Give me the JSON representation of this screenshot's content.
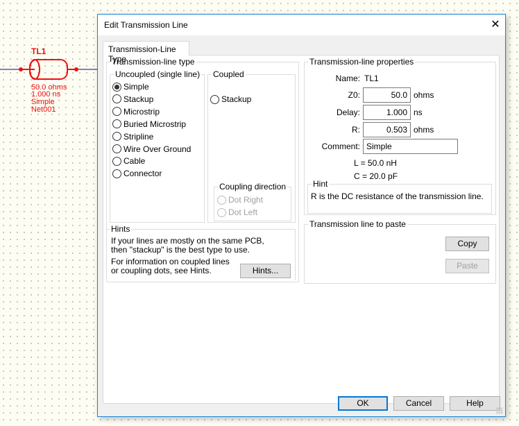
{
  "schematic": {
    "name": "TL1",
    "impedance": "50.0 ohms",
    "delay": "1.000 ns",
    "type": "Simple",
    "net": "Net001"
  },
  "dialog": {
    "title": "Edit Transmission Line",
    "tab": "Transmission-Line Type"
  },
  "line_type": {
    "legend": "Transmission-line type",
    "uncoupled": {
      "legend": "Uncoupled  (single line)",
      "options": [
        "Simple",
        "Stackup",
        "Microstrip",
        "Buried Microstrip",
        "Stripline",
        "Wire Over Ground",
        "Cable",
        "Connector"
      ],
      "selected": "Simple"
    },
    "coupled": {
      "legend": "Coupled",
      "options": [
        "Stackup"
      ]
    },
    "coupling_direction": {
      "legend": "Coupling direction",
      "options": [
        "Dot Right",
        "Dot Left"
      ]
    },
    "hints": {
      "legend": "Hints",
      "text1": "If your lines are mostly on the same PCB, then \"stackup\" is the best type to use.",
      "text2": "For information on coupled lines or coupling dots, see Hints.",
      "button": "Hints..."
    }
  },
  "properties": {
    "legend": "Transmission-line properties",
    "name_label": "Name:",
    "name": "TL1",
    "z0_label": "Z0:",
    "z0": "50.0",
    "z0_unit": "ohms",
    "delay_label": "Delay:",
    "delay": "1.000",
    "delay_unit": "ns",
    "r_label": "R:",
    "r": "0.503",
    "r_unit": "ohms",
    "comment_label": "Comment:",
    "comment": "Simple",
    "l": "L =  50.0 nH",
    "c": "C =  20.0 pF",
    "hint_legend": "Hint",
    "hint": "R is the DC resistance of the transmission line."
  },
  "paste": {
    "legend": "Transmission line to paste",
    "copy": "Copy",
    "paste": "Paste"
  },
  "buttons": {
    "ok": "OK",
    "cancel": "Cancel",
    "help": "Help"
  },
  "colors": {
    "accent": "#0078d7",
    "schematic": "#ee1111",
    "wire": "#0000aa"
  }
}
